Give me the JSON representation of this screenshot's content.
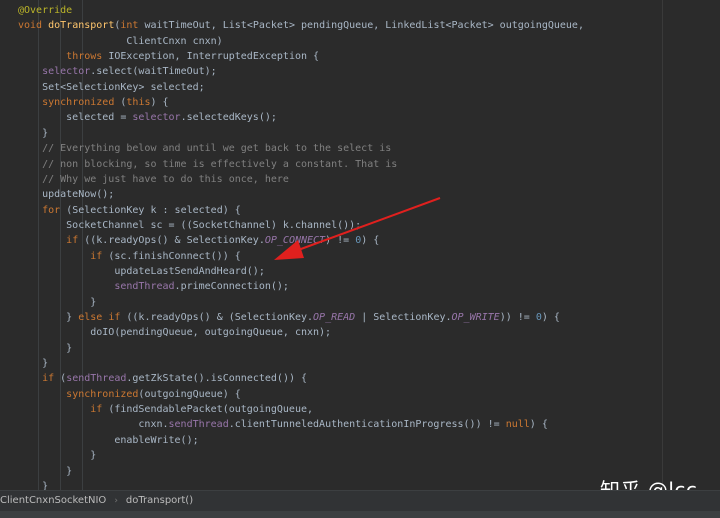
{
  "editor": {
    "lines": [
      [
        [
          "ann",
          "@Override"
        ]
      ],
      [
        [
          "kw",
          "void "
        ],
        [
          "fn",
          "doTransport"
        ],
        [
          "plain",
          "("
        ],
        [
          "kw",
          "int "
        ],
        [
          "plain",
          "waitTimeOut, List<Packet> pendingQueue, LinkedList<Packet> outgoingQueue,"
        ]
      ],
      [
        [
          "plain",
          "                  ClientCnxn cnxn)"
        ]
      ],
      [
        [
          "plain",
          "        "
        ],
        [
          "kw",
          "throws "
        ],
        [
          "plain",
          "IOException, InterruptedException {"
        ]
      ],
      [
        [
          "plain",
          "    "
        ],
        [
          "field",
          "selector"
        ],
        [
          "plain",
          ".select(waitTimeOut);"
        ]
      ],
      [
        [
          "plain",
          "    Set<SelectionKey> selected;"
        ]
      ],
      [
        [
          "plain",
          "    "
        ],
        [
          "kw",
          "synchronized "
        ],
        [
          "plain",
          "("
        ],
        [
          "kw",
          "this"
        ],
        [
          "plain",
          ") {"
        ]
      ],
      [
        [
          "plain",
          "        selected = "
        ],
        [
          "field",
          "selector"
        ],
        [
          "plain",
          ".selectedKeys();"
        ]
      ],
      [
        [
          "plain",
          "    }"
        ]
      ],
      [
        [
          "comment",
          "    // Everything below and until we get back to the select is"
        ]
      ],
      [
        [
          "comment",
          "    // non blocking, so time is effectively a constant. That is"
        ]
      ],
      [
        [
          "comment",
          "    // Why we just have to do this once, here"
        ]
      ],
      [
        [
          "plain",
          "    updateNow();"
        ]
      ],
      [
        [
          "plain",
          "    "
        ],
        [
          "kw",
          "for "
        ],
        [
          "plain",
          "(SelectionKey k : selected) {"
        ]
      ],
      [
        [
          "plain",
          "        SocketChannel sc = ((SocketChannel) k.channel());"
        ]
      ],
      [
        [
          "plain",
          "        "
        ],
        [
          "kw",
          "if "
        ],
        [
          "plain",
          "((k.readyOps() & SelectionKey."
        ],
        [
          "const",
          "OP_CONNECT"
        ],
        [
          "plain",
          ") != "
        ],
        [
          "num",
          "0"
        ],
        [
          "plain",
          ") {"
        ]
      ],
      [
        [
          "plain",
          "            "
        ],
        [
          "kw",
          "if "
        ],
        [
          "plain",
          "(sc.finishConnect()) {"
        ]
      ],
      [
        [
          "plain",
          "                updateLastSendAndHeard();"
        ]
      ],
      [
        [
          "plain",
          "                "
        ],
        [
          "field",
          "sendThread"
        ],
        [
          "plain",
          ".primeConnection();"
        ]
      ],
      [
        [
          "plain",
          "            }"
        ]
      ],
      [
        [
          "plain",
          "        } "
        ],
        [
          "kw",
          "else if "
        ],
        [
          "plain",
          "((k.readyOps() & (SelectionKey."
        ],
        [
          "const",
          "OP_READ"
        ],
        [
          "plain",
          " | SelectionKey."
        ],
        [
          "const",
          "OP_WRITE"
        ],
        [
          "plain",
          ")) != "
        ],
        [
          "num",
          "0"
        ],
        [
          "plain",
          ") {"
        ]
      ],
      [
        [
          "plain",
          "            doIO(pendingQueue, outgoingQueue, cnxn);"
        ]
      ],
      [
        [
          "plain",
          "        }"
        ]
      ],
      [
        [
          "plain",
          "    }"
        ]
      ],
      [
        [
          "plain",
          "    "
        ],
        [
          "kw",
          "if "
        ],
        [
          "plain",
          "("
        ],
        [
          "field",
          "sendThread"
        ],
        [
          "plain",
          ".getZkState().isConnected()) {"
        ]
      ],
      [
        [
          "plain",
          "        "
        ],
        [
          "kw",
          "synchronized"
        ],
        [
          "plain",
          "(outgoingQueue) {"
        ]
      ],
      [
        [
          "plain",
          "            "
        ],
        [
          "kw",
          "if "
        ],
        [
          "plain",
          "(findSendablePacket(outgoingQueue,"
        ]
      ],
      [
        [
          "plain",
          "                    cnxn."
        ],
        [
          "field",
          "sendThread"
        ],
        [
          "plain",
          ".clientTunneledAuthenticationInProgress()) != "
        ],
        [
          "kw",
          "null"
        ],
        [
          "plain",
          ") {"
        ]
      ],
      [
        [
          "plain",
          "                enableWrite();"
        ]
      ],
      [
        [
          "plain",
          "            }"
        ]
      ],
      [
        [
          "plain",
          "        }"
        ]
      ],
      [
        [
          "plain",
          "    }"
        ]
      ]
    ]
  },
  "watermark": "知乎 @lcc",
  "breadcrumb": {
    "class_name": "ClientCnxnSocketNIO",
    "separator": "›",
    "method_name": "doTransport()"
  },
  "colors": {
    "background": "#2b2b2b",
    "keyword": "#cc7832",
    "method": "#ffc66d",
    "field": "#9876aa",
    "comment": "#808080",
    "number": "#6897bb",
    "annotation": "#bbb529",
    "arrow": "#e0201e"
  }
}
